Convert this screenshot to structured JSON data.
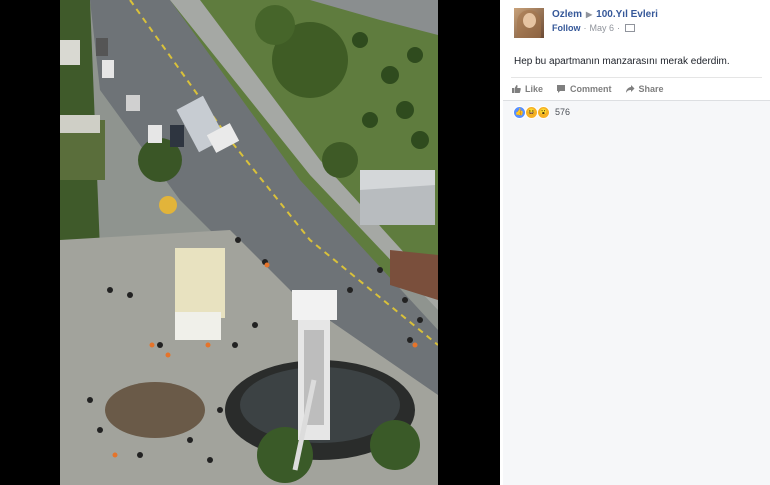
{
  "post": {
    "author": "Ozlem",
    "page": "100.Yıl Evleri",
    "follow_label": "Follow",
    "date": "May 6",
    "separator": "·",
    "caption": "Hep bu apartmanın manzarasını merak ederdim.",
    "actions": [
      {
        "label": "Like",
        "icon": "like-icon"
      },
      {
        "label": "Comment",
        "icon": "comment-icon"
      },
      {
        "label": "Share",
        "icon": "share-icon"
      }
    ],
    "reactions": {
      "icons": [
        "like-reaction-icon",
        "haha-reaction-icon",
        "wow-reaction-icon"
      ],
      "count": "576"
    }
  },
  "colors": {
    "link": "#365899",
    "muted": "#90949c",
    "viewer_bg": "#000000",
    "panel_bg": "#f6f7f9"
  }
}
